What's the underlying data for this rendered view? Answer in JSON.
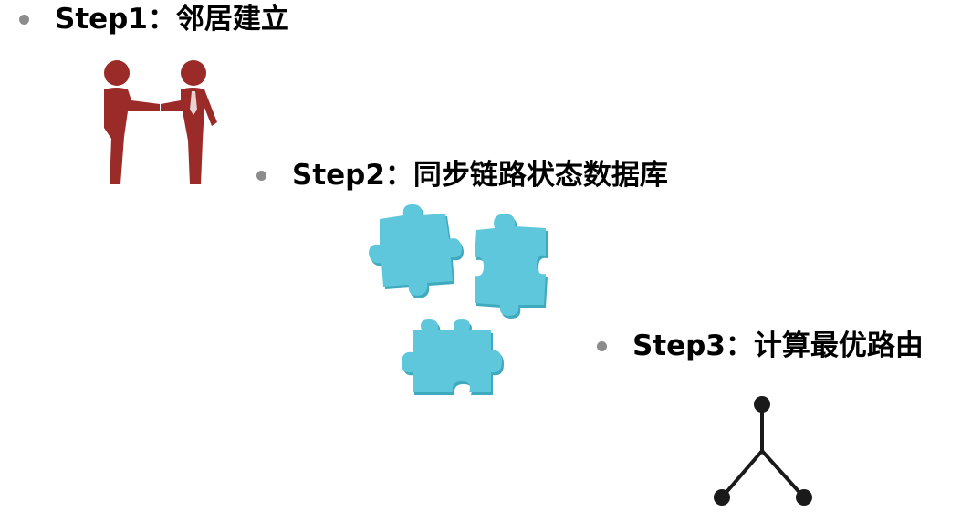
{
  "steps": [
    {
      "label": "Step1：邻居建立",
      "icon": "handshake-icon"
    },
    {
      "label": "Step2：同步链路状态数据库",
      "icon": "puzzle-pieces-icon"
    },
    {
      "label": "Step3：计算最优路由",
      "icon": "tree-graph-icon"
    }
  ],
  "colors": {
    "bullet": "#8c8c8c",
    "text": "#000000",
    "handshake": "#9b2b28",
    "puzzle": "#5ec7db",
    "puzzle_shadow": "#3fa9bd",
    "tree": "#1a1a1a"
  }
}
